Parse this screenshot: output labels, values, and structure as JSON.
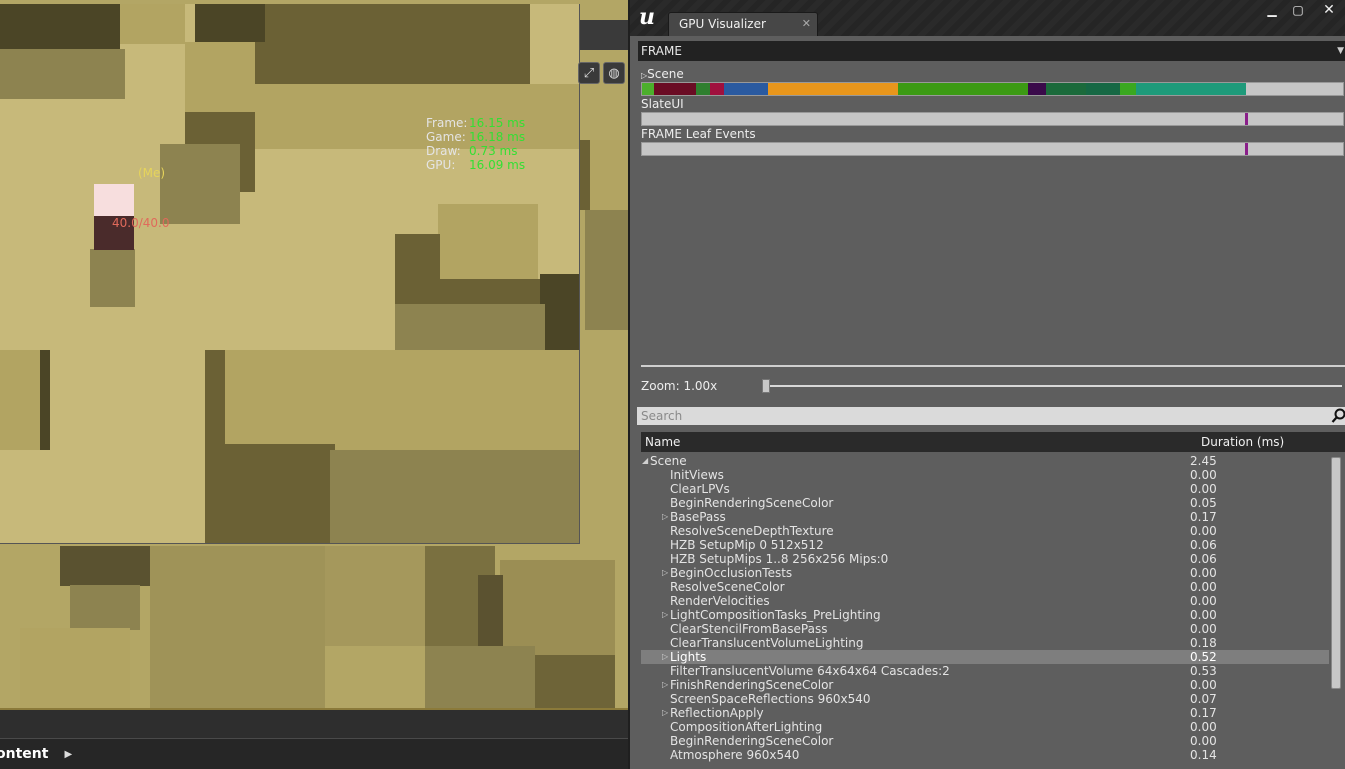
{
  "viewport": {
    "stats": [
      {
        "label": "Frame:",
        "value": "16.15 ms"
      },
      {
        "label": "Game:",
        "value": "16.18 ms"
      },
      {
        "label": "Draw:",
        "value": "0.73 ms"
      },
      {
        "label": "GPU:",
        "value": "16.09 ms"
      }
    ],
    "player_label": "(Me)",
    "health_text": "40.0/40.0",
    "content_label": "ontent"
  },
  "gpu_visualizer": {
    "tab_title": "GPU Visualizer",
    "frame_dropdown": "FRAME",
    "timelines": [
      {
        "label": "Scene"
      },
      {
        "label": "SlateUI"
      },
      {
        "label": "FRAME Leaf Events"
      }
    ],
    "zoom_label": "Zoom: 1.00x",
    "zoom_value": 1.0,
    "search_placeholder": "Search",
    "table": {
      "col_name": "Name",
      "col_duration": "Duration (ms)",
      "rows": [
        {
          "name": "Scene",
          "duration": "2.45",
          "expander": "open",
          "level": 0
        },
        {
          "name": "InitViews",
          "duration": "0.00",
          "expander": "none",
          "level": 1
        },
        {
          "name": "ClearLPVs",
          "duration": "0.00",
          "expander": "none",
          "level": 1
        },
        {
          "name": "BeginRenderingSceneColor",
          "duration": "0.05",
          "expander": "none",
          "level": 1
        },
        {
          "name": "BasePass",
          "duration": "0.17",
          "expander": "closed",
          "level": 1
        },
        {
          "name": "ResolveSceneDepthTexture",
          "duration": "0.00",
          "expander": "none",
          "level": 1
        },
        {
          "name": "HZB SetupMip 0 512x512",
          "duration": "0.06",
          "expander": "none",
          "level": 1
        },
        {
          "name": "HZB SetupMips 1..8 256x256 Mips:0",
          "duration": "0.06",
          "expander": "none",
          "level": 1
        },
        {
          "name": "BeginOcclusionTests",
          "duration": "0.00",
          "expander": "closed",
          "level": 1
        },
        {
          "name": "ResolveSceneColor",
          "duration": "0.00",
          "expander": "none",
          "level": 1
        },
        {
          "name": "RenderVelocities",
          "duration": "0.00",
          "expander": "none",
          "level": 1
        },
        {
          "name": "LightCompositionTasks_PreLighting",
          "duration": "0.00",
          "expander": "closed",
          "level": 1
        },
        {
          "name": "ClearStencilFromBasePass",
          "duration": "0.00",
          "expander": "none",
          "level": 1
        },
        {
          "name": "ClearTranslucentVolumeLighting",
          "duration": "0.18",
          "expander": "none",
          "level": 1
        },
        {
          "name": "Lights",
          "duration": "0.52",
          "expander": "closed",
          "level": 1,
          "selected": true
        },
        {
          "name": "FilterTranslucentVolume 64x64x64 Cascades:2",
          "duration": "0.53",
          "expander": "none",
          "level": 1
        },
        {
          "name": "FinishRenderingSceneColor",
          "duration": "0.00",
          "expander": "closed",
          "level": 1
        },
        {
          "name": "ScreenSpaceReflections 960x540",
          "duration": "0.07",
          "expander": "none",
          "level": 1
        },
        {
          "name": "ReflectionApply",
          "duration": "0.17",
          "expander": "closed",
          "level": 1
        },
        {
          "name": "CompositionAfterLighting",
          "duration": "0.00",
          "expander": "none",
          "level": 1
        },
        {
          "name": "BeginRenderingSceneColor",
          "duration": "0.00",
          "expander": "none",
          "level": 1
        },
        {
          "name": "Atmosphere 960x540",
          "duration": "0.14",
          "expander": "none",
          "level": 1
        }
      ]
    }
  }
}
